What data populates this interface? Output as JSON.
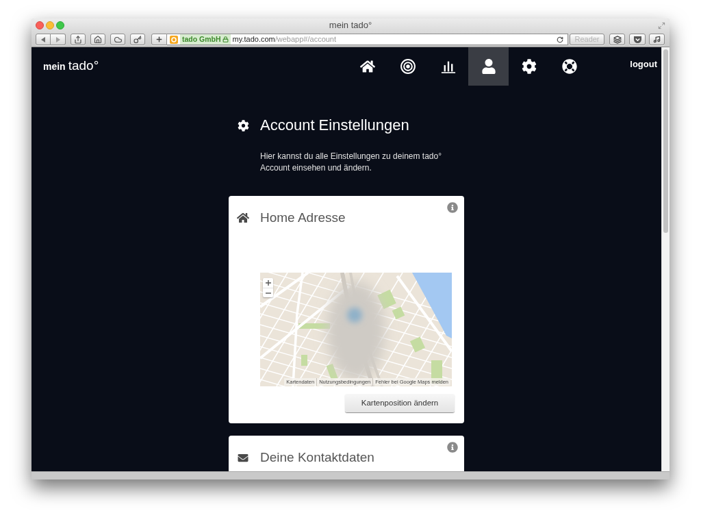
{
  "browser": {
    "title": "mein tado°",
    "site_identity": "tado GmbH",
    "url": {
      "host": "my.tado.com",
      "path": "/webapp#/account"
    },
    "reader": {
      "label": "Reader",
      "disabled": true
    }
  },
  "nav": {
    "logo": {
      "prefix": "mein",
      "brand": "tado°"
    },
    "items": [
      {
        "kind": "home",
        "selected": false
      },
      {
        "kind": "target",
        "selected": false
      },
      {
        "kind": "chart",
        "selected": false
      },
      {
        "kind": "user",
        "selected": true
      },
      {
        "kind": "gear",
        "selected": false
      },
      {
        "kind": "lifebuoy",
        "selected": false
      }
    ],
    "logout": "logout"
  },
  "page": {
    "title": "Account Einstellungen",
    "intro": "Hier kannst du alle Einstellungen zu deinem tado° Account einsehen und ändern."
  },
  "cards": [
    {
      "kind": "home",
      "title": "Home Adresse",
      "map": {
        "attribution": [
          "Kartendaten",
          "Nutzungsbedingungen",
          "Fehler bei Google Maps melden"
        ]
      },
      "button": "Kartenposition ändern"
    },
    {
      "kind": "envelope",
      "title": "Deine Kontaktdaten"
    }
  ]
}
